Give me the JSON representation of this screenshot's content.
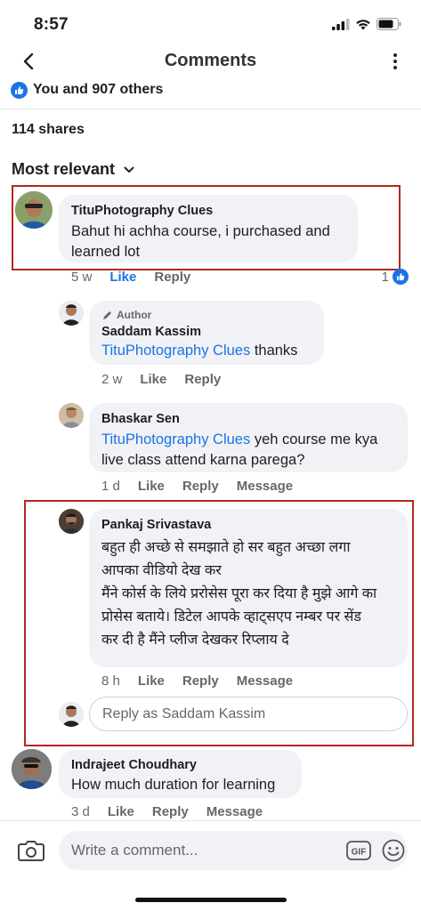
{
  "status": {
    "time": "8:57"
  },
  "nav": {
    "title": "Comments"
  },
  "post": {
    "likes_text": "You and 907 others",
    "shares_text": "114 shares"
  },
  "sort": {
    "label": "Most relevant"
  },
  "comments": [
    {
      "author": "TituPhotography Clues",
      "text": "Bahut hi achha course, i purchased and learned lot",
      "time": "5 w",
      "like": "Like",
      "reply": "Reply",
      "reaction_count": "1"
    },
    {
      "badge": "Author",
      "author": "Saddam Kassim",
      "tag": "TituPhotography Clues",
      "text": " thanks",
      "time": "2 w",
      "like": "Like",
      "reply": "Reply"
    },
    {
      "author": "Bhaskar Sen",
      "tag": "TituPhotography Clues",
      "text": " yeh course me kya live class attend karna parega?",
      "time": "1 d",
      "like": "Like",
      "reply": "Reply",
      "message": "Message"
    },
    {
      "author": "Pankaj Srivastava",
      "line1": "बहुत ही अच्छे से समझाते हो सर बहुत अच्छा लगा",
      "line2": "आपका वीडियो देख कर",
      "line3": "मैंने कोर्स के लिये प्ररोसेस पूरा कर दिया है मुझे आगे का",
      "line4": "प्रोसेस बताये। डिटेल आपके व्हाट्सएप नम्बर पर सेंड",
      "line5": "कर दी है मैंने प्लीज देखकर रिप्लाय दे",
      "time": "8 h",
      "like": "Like",
      "reply": "Reply",
      "message": "Message"
    },
    {
      "author": "Indrajeet Choudhary",
      "text": "How much duration for learning",
      "time": "3 d",
      "like": "Like",
      "reply": "Reply",
      "message": "Message"
    }
  ],
  "reply_box": {
    "placeholder": "Reply as Saddam Kassim"
  },
  "composer": {
    "placeholder": "Write a comment...",
    "gif_label": "GIF"
  },
  "colors": {
    "accent": "#1b74e4",
    "highlight": "#b3261e",
    "bubble": "#f0f2f5"
  }
}
